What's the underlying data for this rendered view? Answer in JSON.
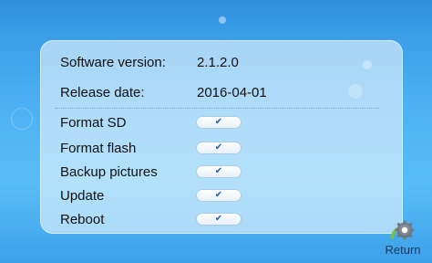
{
  "info": {
    "software_version_label": "Software version:",
    "software_version_value": "2.1.2.0",
    "release_date_label": "Release date:",
    "release_date_value": "2016-04-01"
  },
  "actions": [
    {
      "label": "Format SD",
      "toggle_glyph": "✔"
    },
    {
      "label": "Format flash",
      "toggle_glyph": "✔"
    },
    {
      "label": "Backup pictures",
      "toggle_glyph": "✔"
    },
    {
      "label": "Update",
      "toggle_glyph": "✔"
    },
    {
      "label": "Reboot",
      "toggle_glyph": "✔"
    }
  ],
  "footer": {
    "return_label": "Return",
    "return_icon": "gear-icon"
  },
  "colors": {
    "background_top": "#2f90dc",
    "background_mid": "#58bdf6",
    "panel": "#e8f6ff",
    "check": "#1662b8",
    "gear": "#5f6a74",
    "gear_accent": "#7bc043"
  }
}
